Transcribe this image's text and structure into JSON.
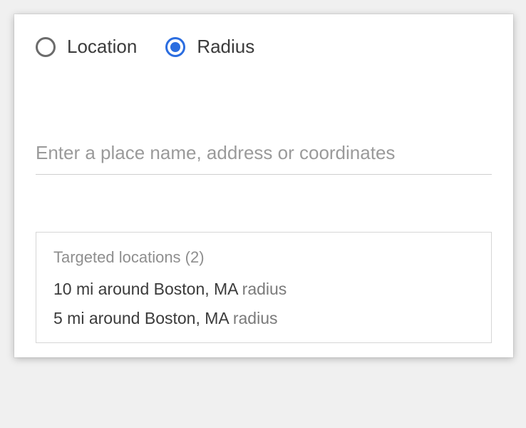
{
  "radios": {
    "location": {
      "label": "Location",
      "selected": false
    },
    "radius": {
      "label": "Radius",
      "selected": true
    }
  },
  "search": {
    "placeholder": "Enter a place name, address or coordinates",
    "value": ""
  },
  "targeted": {
    "header": "Targeted locations (2)",
    "items": [
      {
        "main": "10 mi around Boston, MA",
        "suffix": " radius"
      },
      {
        "main": "5 mi around Boston, MA",
        "suffix": " radius"
      }
    ]
  }
}
